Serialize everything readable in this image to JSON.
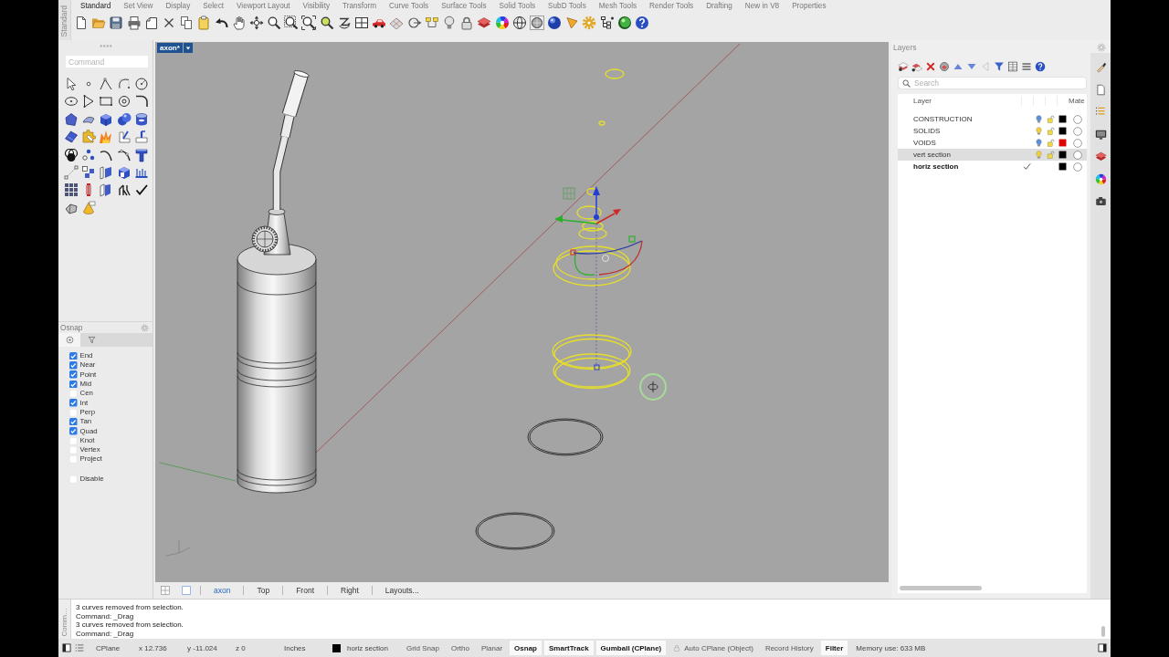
{
  "ribbon": {
    "side_label": "Standard",
    "tabs": [
      {
        "label": "Standard",
        "selected": true
      },
      {
        "label": "Set View",
        "selected": false
      },
      {
        "label": "Display",
        "selected": false
      },
      {
        "label": "Select",
        "selected": false
      },
      {
        "label": "Viewport Layout",
        "selected": false
      },
      {
        "label": "Visibility",
        "selected": false
      },
      {
        "label": "Transform",
        "selected": false
      },
      {
        "label": "Curve Tools",
        "selected": false
      },
      {
        "label": "Surface Tools",
        "selected": false
      },
      {
        "label": "Solid Tools",
        "selected": false
      },
      {
        "label": "SubD Tools",
        "selected": false
      },
      {
        "label": "Mesh Tools",
        "selected": false
      },
      {
        "label": "Render Tools",
        "selected": false
      },
      {
        "label": "Drafting",
        "selected": false
      },
      {
        "label": "New in V8",
        "selected": false
      },
      {
        "label": "Properties",
        "selected": false
      }
    ]
  },
  "command_field": {
    "placeholder": "Command"
  },
  "osnap": {
    "title": "Osnap",
    "tabs": [
      {
        "selected": true
      },
      {
        "selected": false
      }
    ],
    "items": [
      {
        "label": "End",
        "checked": true
      },
      {
        "label": "Near",
        "checked": true
      },
      {
        "label": "Point",
        "checked": true
      },
      {
        "label": "Mid",
        "checked": true
      },
      {
        "label": "Cen",
        "checked": false
      },
      {
        "label": "Int",
        "checked": true
      },
      {
        "label": "Perp",
        "checked": false
      },
      {
        "label": "Tan",
        "checked": true
      },
      {
        "label": "Quad",
        "checked": true
      },
      {
        "label": "Knot",
        "checked": false
      },
      {
        "label": "Vertex",
        "checked": false
      },
      {
        "label": "Project",
        "checked": false
      }
    ],
    "disable": {
      "label": "Disable",
      "checked": false
    }
  },
  "viewport": {
    "title": "axon*",
    "tabs": [
      {
        "label": "axon",
        "selected": true
      },
      {
        "label": "Top",
        "selected": false
      },
      {
        "label": "Front",
        "selected": false
      },
      {
        "label": "Right",
        "selected": false
      },
      {
        "label": "Layouts...",
        "selected": false
      }
    ]
  },
  "layers": {
    "title": "Layers",
    "search": {
      "placeholder": "Search"
    },
    "columns": [
      "Layer",
      "Mate"
    ],
    "rows": [
      {
        "name": "CONSTRUCTION",
        "selected": false,
        "current": false,
        "visible": false,
        "locked": false,
        "color": "#000000"
      },
      {
        "name": "SOLIDS",
        "selected": false,
        "current": false,
        "visible": true,
        "locked": false,
        "color": "#000000"
      },
      {
        "name": "VOIDS",
        "selected": false,
        "current": false,
        "visible": false,
        "locked": false,
        "color": "#e00000"
      },
      {
        "name": "vert section",
        "selected": true,
        "current": false,
        "visible": true,
        "locked": false,
        "color": "#000000"
      },
      {
        "name": "horiz section",
        "selected": false,
        "current": true,
        "color": "#000000"
      }
    ]
  },
  "command_history": {
    "label": "Comm…",
    "lines": [
      "3 curves removed from selection.",
      "Command: _Drag",
      "3 curves removed from selection.",
      "Command: _Drag"
    ]
  },
  "status_bar": {
    "cplane": "CPlane",
    "coordinates": [
      "x 12.736",
      "y -11.024",
      "z 0"
    ],
    "units": "Inches",
    "layer": {
      "name": "horiz section",
      "color": "#000000"
    },
    "toggles": [
      {
        "label": "Grid Snap",
        "on": false,
        "kind": "toggle"
      },
      {
        "label": "Ortho",
        "on": false,
        "kind": "toggle"
      },
      {
        "label": "Planar",
        "on": false,
        "kind": "toggle"
      },
      {
        "label": "Osnap",
        "on": true,
        "kind": "toggle"
      },
      {
        "label": "SmartTrack",
        "on": true,
        "kind": "toggle"
      },
      {
        "label": "Gumball (CPlane)",
        "on": true,
        "kind": "toggle"
      },
      {
        "label": "Auto CPlane (Object)",
        "on": false,
        "kind": "lock-toggle"
      },
      {
        "label": "Record History",
        "on": false,
        "kind": "toggle"
      },
      {
        "label": "Filter",
        "on": true,
        "kind": "toggle"
      }
    ],
    "memory": "Memory use: 633 MB"
  }
}
